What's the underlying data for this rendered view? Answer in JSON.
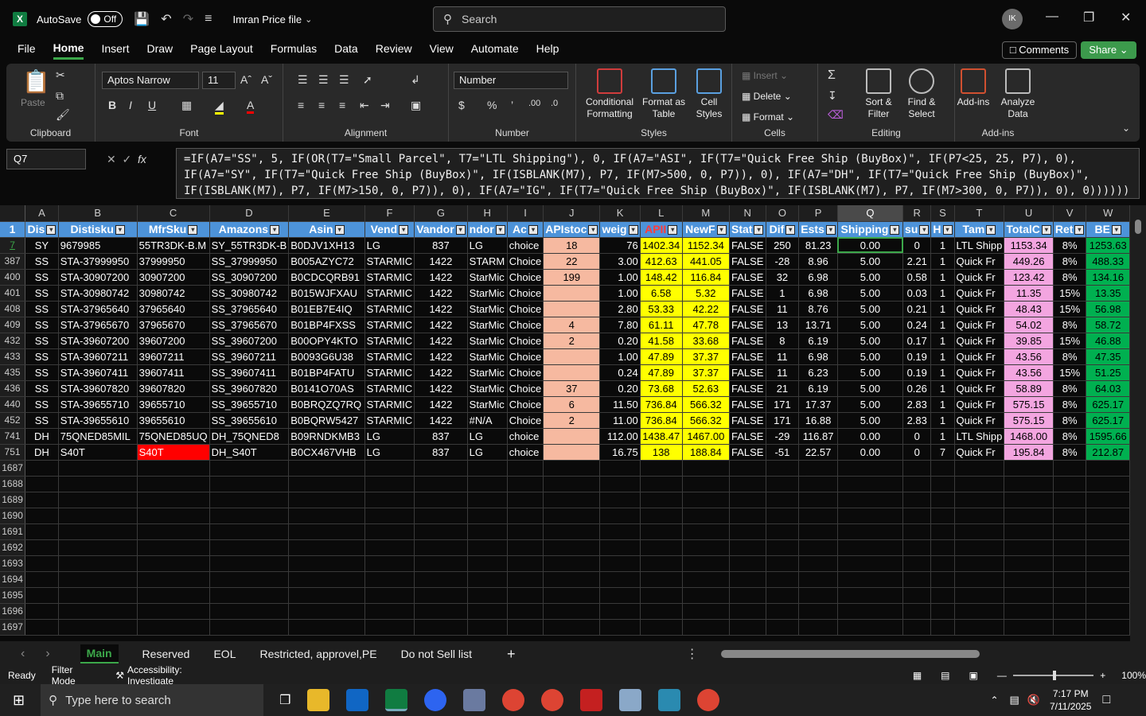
{
  "titlebar": {
    "autosave": "AutoSave",
    "toggle": "Off",
    "filename": "Imran Price file",
    "search": "Search",
    "avatar": "IK"
  },
  "menu": [
    "File",
    "Home",
    "Insert",
    "Draw",
    "Page Layout",
    "Formulas",
    "Data",
    "Review",
    "View",
    "Automate",
    "Help"
  ],
  "buttons": {
    "comments": "Comments",
    "share": "Share"
  },
  "ribbon": {
    "clipboard": {
      "label": "Clipboard",
      "paste": "Paste"
    },
    "font": {
      "label": "Font",
      "name": "Aptos Narrow",
      "size": "11"
    },
    "alignment": {
      "label": "Alignment"
    },
    "number": {
      "label": "Number",
      "format": "Number"
    },
    "styles": {
      "label": "Styles",
      "cond": "Conditional Formatting",
      "table": "Format as Table",
      "cell": "Cell Styles"
    },
    "cells": {
      "label": "Cells",
      "insert": "Insert",
      "delete": "Delete",
      "format": "Format"
    },
    "editing": {
      "label": "Editing",
      "sort": "Sort & Filter",
      "find": "Find & Select"
    },
    "addins": {
      "label": "Add-ins",
      "addins": "Add-ins",
      "analyze": "Analyze Data"
    }
  },
  "namebox": "Q7",
  "formula": "=IF(A7=\"SS\", 5, IF(OR(T7=\"Small Parcel\", T7=\"LTL Shipping\"), 0, IF(A7=\"ASI\", IF(T7=\"Quick Free Ship (BuyBox)\", IF(P7<25, 25, P7), 0), IF(A7=\"SY\", IF(T7=\"Quick Free Ship (BuyBox)\", IF(ISBLANK(M7), P7, IF(M7>500, 0, P7)), 0), IF(A7=\"DH\", IF(T7=\"Quick Free Ship (BuyBox)\", IF(ISBLANK(M7), P7, IF(M7>150, 0, P7)), 0), IF(A7=\"IG\", IF(T7=\"Quick Free Ship (BuyBox)\", IF(ISBLANK(M7), P7, IF(M7>300, 0, P7)), 0), 0))))))",
  "columns": [
    "A",
    "B",
    "C",
    "D",
    "E",
    "F",
    "G",
    "H",
    "I",
    "J",
    "K",
    "L",
    "M",
    "N",
    "O",
    "P",
    "Q",
    "R",
    "S",
    "T",
    "U",
    "V",
    "W"
  ],
  "headers": [
    "Dis",
    "Distisku",
    "MfrSku",
    "Amazons",
    "Asin",
    "Vend",
    "Vandor",
    "ndor",
    "Ac",
    "APIstoc",
    "weig",
    "APII",
    "NewF",
    "Stat",
    "Dif",
    "Ests",
    "Shipping",
    "su",
    "H",
    "Tam",
    "TotalC",
    "Ret",
    "BE"
  ],
  "rows": [
    {
      "n": "7",
      "cells": [
        "SY",
        "9679985",
        "55TR3DK-B.M",
        "SY_55TR3DK-B",
        "B0DJV1XH13",
        "LG",
        "837",
        "LG",
        "choice",
        "18",
        "76",
        "1402.34",
        "1152.34",
        "FALSE",
        "250",
        "81.23",
        "0.00",
        "0",
        "1",
        "LTL Shipp",
        "1153.34",
        "8%",
        "1253.63"
      ]
    },
    {
      "n": "387",
      "cells": [
        "SS",
        "STA-37999950",
        "37999950",
        "SS_37999950",
        "B005AZYC72",
        "STARMIC",
        "1422",
        "STARM",
        "Choice",
        "22",
        "3.00",
        "412.63",
        "441.05",
        "FALSE",
        "-28",
        "8.96",
        "5.00",
        "2.21",
        "1",
        "Quick Fr",
        "449.26",
        "8%",
        "488.33"
      ]
    },
    {
      "n": "400",
      "cells": [
        "SS",
        "STA-30907200",
        "30907200",
        "SS_30907200",
        "B0CDCQRB91",
        "STARMIC",
        "1422",
        "StarMic",
        "Choice",
        "199",
        "1.00",
        "148.42",
        "116.84",
        "FALSE",
        "32",
        "6.98",
        "5.00",
        "0.58",
        "1",
        "Quick Fr",
        "123.42",
        "8%",
        "134.16"
      ]
    },
    {
      "n": "401",
      "cells": [
        "SS",
        "STA-30980742",
        "30980742",
        "SS_30980742",
        "B015WJFXAU",
        "STARMIC",
        "1422",
        "StarMic",
        "Choice",
        "",
        "1.00",
        "6.58",
        "5.32",
        "FALSE",
        "1",
        "6.98",
        "5.00",
        "0.03",
        "1",
        "Quick Fr",
        "11.35",
        "15%",
        "13.35"
      ]
    },
    {
      "n": "408",
      "cells": [
        "SS",
        "STA-37965640",
        "37965640",
        "SS_37965640",
        "B01EB7E4IQ",
        "STARMIC",
        "1422",
        "StarMic",
        "Choice",
        "",
        "2.80",
        "53.33",
        "42.22",
        "FALSE",
        "11",
        "8.76",
        "5.00",
        "0.21",
        "1",
        "Quick Fr",
        "48.43",
        "15%",
        "56.98"
      ]
    },
    {
      "n": "409",
      "cells": [
        "SS",
        "STA-37965670",
        "37965670",
        "SS_37965670",
        "B01BP4FXSS",
        "STARMIC",
        "1422",
        "StarMic",
        "Choice",
        "4",
        "7.80",
        "61.11",
        "47.78",
        "FALSE",
        "13",
        "13.71",
        "5.00",
        "0.24",
        "1",
        "Quick Fr",
        "54.02",
        "8%",
        "58.72"
      ]
    },
    {
      "n": "432",
      "cells": [
        "SS",
        "STA-39607200",
        "39607200",
        "SS_39607200",
        "B00OPY4KTO",
        "STARMIC",
        "1422",
        "StarMic",
        "Choice",
        "2",
        "0.20",
        "41.58",
        "33.68",
        "FALSE",
        "8",
        "6.19",
        "5.00",
        "0.17",
        "1",
        "Quick Fr",
        "39.85",
        "15%",
        "46.88"
      ]
    },
    {
      "n": "433",
      "cells": [
        "SS",
        "STA-39607211",
        "39607211",
        "SS_39607211",
        "B0093G6U38",
        "STARMIC",
        "1422",
        "StarMic",
        "Choice",
        "",
        "1.00",
        "47.89",
        "37.37",
        "FALSE",
        "11",
        "6.98",
        "5.00",
        "0.19",
        "1",
        "Quick Fr",
        "43.56",
        "8%",
        "47.35"
      ]
    },
    {
      "n": "435",
      "cells": [
        "SS",
        "STA-39607411",
        "39607411",
        "SS_39607411",
        "B01BP4FATU",
        "STARMIC",
        "1422",
        "StarMic",
        "Choice",
        "",
        "0.24",
        "47.89",
        "37.37",
        "FALSE",
        "11",
        "6.23",
        "5.00",
        "0.19",
        "1",
        "Quick Fr",
        "43.56",
        "15%",
        "51.25"
      ]
    },
    {
      "n": "436",
      "cells": [
        "SS",
        "STA-39607820",
        "39607820",
        "SS_39607820",
        "B0141O70AS",
        "STARMIC",
        "1422",
        "StarMic",
        "Choice",
        "37",
        "0.20",
        "73.68",
        "52.63",
        "FALSE",
        "21",
        "6.19",
        "5.00",
        "0.26",
        "1",
        "Quick Fr",
        "58.89",
        "8%",
        "64.03"
      ]
    },
    {
      "n": "440",
      "cells": [
        "SS",
        "STA-39655710",
        "39655710",
        "SS_39655710",
        "B0BRQZQ7RQ",
        "STARMIC",
        "1422",
        "StarMic",
        "Choice",
        "6",
        "11.50",
        "736.84",
        "566.32",
        "FALSE",
        "171",
        "17.37",
        "5.00",
        "2.83",
        "1",
        "Quick Fr",
        "575.15",
        "8%",
        "625.17"
      ]
    },
    {
      "n": "452",
      "cells": [
        "SS",
        "STA-39655610",
        "39655610",
        "SS_39655610",
        "B0BQRW5427",
        "STARMIC",
        "1422",
        "#N/A",
        "Choice",
        "2",
        "11.00",
        "736.84",
        "566.32",
        "FALSE",
        "171",
        "16.88",
        "5.00",
        "2.83",
        "1",
        "Quick Fr",
        "575.15",
        "8%",
        "625.17"
      ]
    },
    {
      "n": "741",
      "cells": [
        "DH",
        "75QNED85MIL",
        "75QNED85UQ",
        "DH_75QNED8",
        "B09RNDKMB3",
        "LG",
        "837",
        "LG",
        "choice",
        "",
        "112.00",
        "1438.47",
        "1467.00",
        "FALSE",
        "-29",
        "116.87",
        "0.00",
        "0",
        "1",
        "LTL Shipp",
        "1468.00",
        "8%",
        "1595.66"
      ]
    },
    {
      "n": "751",
      "cells": [
        "DH",
        "S40T",
        "S40T",
        "DH_S40T",
        "B0CX467VHB",
        "LG",
        "837",
        "LG",
        "choice",
        "",
        "16.75",
        "138",
        "188.84",
        "FALSE",
        "-51",
        "22.57",
        "0.00",
        "0",
        "7",
        "Quick Fr",
        "195.84",
        "8%",
        "212.87"
      ]
    }
  ],
  "empty_rows": [
    "1687",
    "1688",
    "1689",
    "1690",
    "1691",
    "1692",
    "1693",
    "1694",
    "1695",
    "1696",
    "1697"
  ],
  "sheets": [
    "Main",
    "Reserved",
    "EOL",
    "Restricted, approvel,PE",
    "Do not Sell list"
  ],
  "status": {
    "ready": "Ready",
    "filter": "Filter Mode",
    "access": "Accessibility: Investigate",
    "zoom": "100%"
  },
  "taskbar": {
    "search": "Type here to search",
    "time": "7:17 PM",
    "date": "7/11/2025"
  },
  "colors": {
    "header": "#4d93d9",
    "peach": "#f6b9a0",
    "yellow": "#ffff00",
    "pink": "#f3a5e0",
    "green": "#00b050",
    "red": "#ff0000",
    "accent": "#3ca84a"
  }
}
